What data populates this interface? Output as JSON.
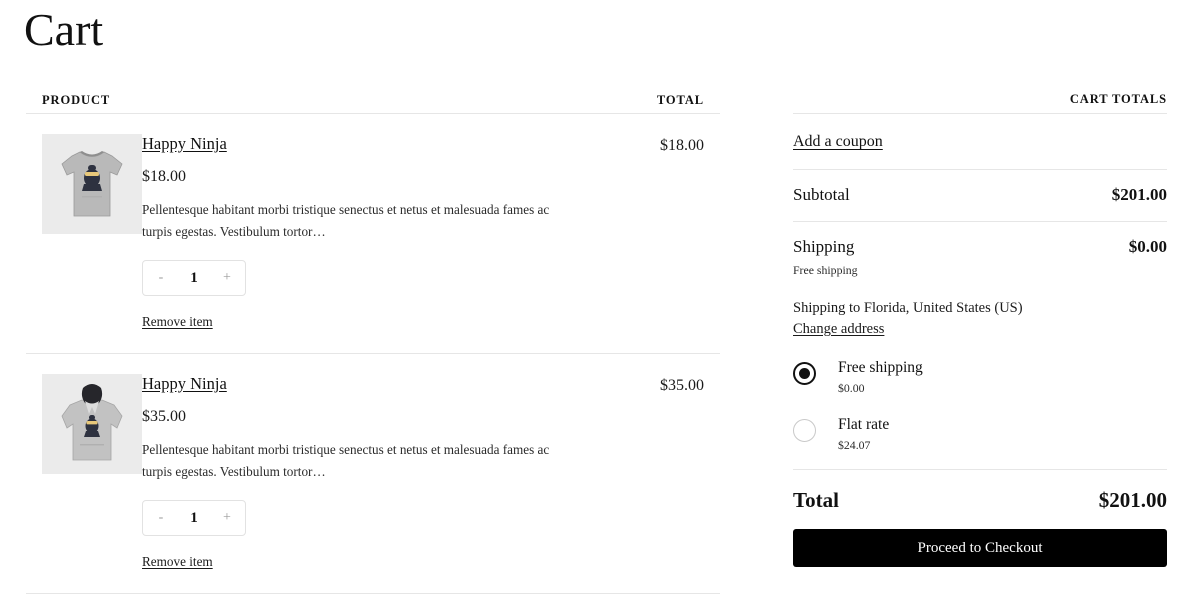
{
  "page": {
    "title": "Cart"
  },
  "cart_table": {
    "headers": {
      "product": "PRODUCT",
      "total": "TOTAL"
    },
    "items": [
      {
        "thumb_icon": "tshirt-thumbnail",
        "name": "Happy Ninja",
        "price": "$18.00",
        "description": "Pellentesque habitant morbi tristique senectus et netus et malesuada fames ac turpis egestas. Vestibulum tortor…",
        "qty": "1",
        "minus_label": "-",
        "plus_label": "+",
        "remove_label": "Remove item",
        "line_total": "$18.00"
      },
      {
        "thumb_icon": "hoodie-thumbnail",
        "name": "Happy Ninja",
        "price": "$35.00",
        "description": "Pellentesque habitant morbi tristique senectus et netus et malesuada fames ac turpis egestas. Vestibulum tortor…",
        "qty": "1",
        "minus_label": "-",
        "plus_label": "+",
        "remove_label": "Remove item",
        "line_total": "$35.00"
      }
    ]
  },
  "cart_totals": {
    "heading": "CART TOTALS",
    "coupon_link": "Add a coupon",
    "subtotal_label": "Subtotal",
    "subtotal_value": "$201.00",
    "shipping_label": "Shipping",
    "shipping_value": "$0.00",
    "shipping_note": "Free shipping",
    "shipping_to": "Shipping to Florida, United States (US)",
    "change_address_link": "Change address",
    "shipping_options": [
      {
        "name": "Free shipping",
        "cost": "$0.00",
        "selected": true
      },
      {
        "name": "Flat rate",
        "cost": "$24.07",
        "selected": false
      }
    ],
    "total_label": "Total",
    "total_value": "$201.00",
    "checkout_label": "Proceed to Checkout"
  },
  "colors": {
    "accent": "#000000",
    "text": "#111111",
    "divider": "#e6e6e6",
    "thumb_bg": "#ebebeb"
  }
}
